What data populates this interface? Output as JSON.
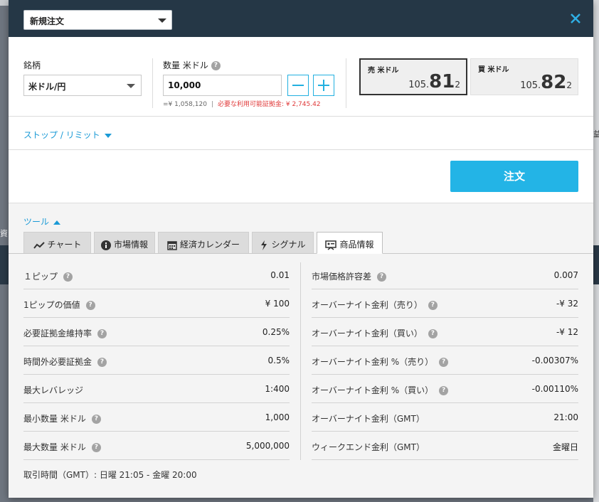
{
  "header": {
    "order_type": "新規注文"
  },
  "order": {
    "symbol_label": "銘柄",
    "symbol_value": "米ドル/円",
    "qty_label": "数量 米ドル",
    "qty_value": "10,000",
    "qty_equiv": "=¥ 1,058,120",
    "margin_needed": "必要な利用可能証拠金: ¥ 2,745.42"
  },
  "quotes": {
    "sell": {
      "label": "売 米ドル",
      "pre": "105.",
      "big": "81",
      "small": "2"
    },
    "buy": {
      "label": "買 米ドル",
      "pre": "105.",
      "big": "82",
      "small": "2"
    }
  },
  "stop_limit": {
    "label": "ストップ / リミット"
  },
  "submit": {
    "label": "注文"
  },
  "tools": {
    "toggle_label": "ツール",
    "tabs": [
      {
        "label": "チャート",
        "icon": "chart-line-icon"
      },
      {
        "label": "市場情報",
        "icon": "info-icon"
      },
      {
        "label": "経済カレンダー",
        "icon": "calendar-icon"
      },
      {
        "label": "シグナル",
        "icon": "signal-icon"
      },
      {
        "label": "商品情報",
        "icon": "presentation-icon"
      }
    ],
    "active_tab": "商品情報"
  },
  "product_info": {
    "left": [
      {
        "key": "１ピップ",
        "value": "0.01",
        "help": true
      },
      {
        "key": "1ピップの価値",
        "value": "¥ 100",
        "help": true
      },
      {
        "key": "必要証拠金維持率",
        "value": "0.25%",
        "help": true
      },
      {
        "key": "時間外必要証拠金",
        "value": "0.5%",
        "help": true
      },
      {
        "key": "最大レバレッジ",
        "value": "1:400",
        "help": false
      },
      {
        "key": "最小数量 米ドル",
        "value": "1,000",
        "help": true
      },
      {
        "key": "最大数量 米ドル",
        "value": "5,000,000",
        "help": true
      }
    ],
    "right": [
      {
        "key": "市場価格許容差",
        "value": "0.007",
        "help": true
      },
      {
        "key": "オーバーナイト金利（売り）",
        "value": "-¥ 32",
        "help": true
      },
      {
        "key": "オーバーナイト金利（買い）",
        "value": "-¥ 12",
        "help": true
      },
      {
        "key": "オーバーナイト金利 %（売り）",
        "value": "-0.00307%",
        "help": true
      },
      {
        "key": "オーバーナイト金利 %（買い）",
        "value": "-0.00110%",
        "help": true
      },
      {
        "key": "オーバーナイト金利（GMT）",
        "value": "21:00",
        "help": false
      },
      {
        "key": "ウィークエンド金利（GMT）",
        "value": "金曜日",
        "help": false
      }
    ],
    "trading_hours": "取引時間（GMT）: 日曜 21:05 - 金曜 20:00"
  },
  "background": {
    "left_glimpse": "資",
    "right_glimpse": "益"
  },
  "colors": {
    "header_bg": "#253746",
    "accent": "#23b4e6",
    "warning": "#e03a3a"
  }
}
